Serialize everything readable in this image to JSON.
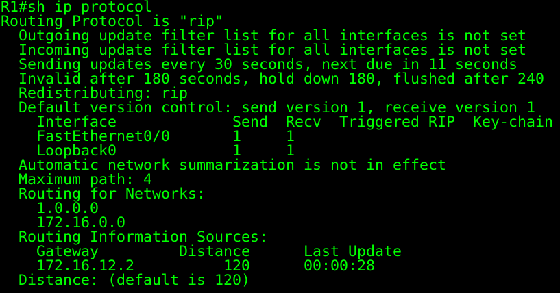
{
  "theme": {
    "background": "#000000",
    "foreground": "#00ff00"
  },
  "terminal": {
    "lines": [
      "R1#sh ip protocol",
      "Routing Protocol is \"rip\"",
      "  Outgoing update filter list for all interfaces is not set",
      "  Incoming update filter list for all interfaces is not set",
      "  Sending updates every 30 seconds, next due in 11 seconds",
      "  Invalid after 180 seconds, hold down 180, flushed after 240",
      "  Redistributing: rip",
      "  Default version control: send version 1, receive version 1",
      "    Interface             Send  Recv  Triggered RIP  Key-chain",
      "    FastEthernet0/0       1     1",
      "    Loopback0             1     1",
      "  Automatic network summarization is not in effect",
      "  Maximum path: 4",
      "  Routing for Networks:",
      "    1.0.0.0",
      "    172.16.0.0",
      "  Routing Information Sources:",
      "    Gateway         Distance      Last Update",
      "    172.16.12.2          120      00:00:28",
      "  Distance: (default is 120)"
    ]
  }
}
